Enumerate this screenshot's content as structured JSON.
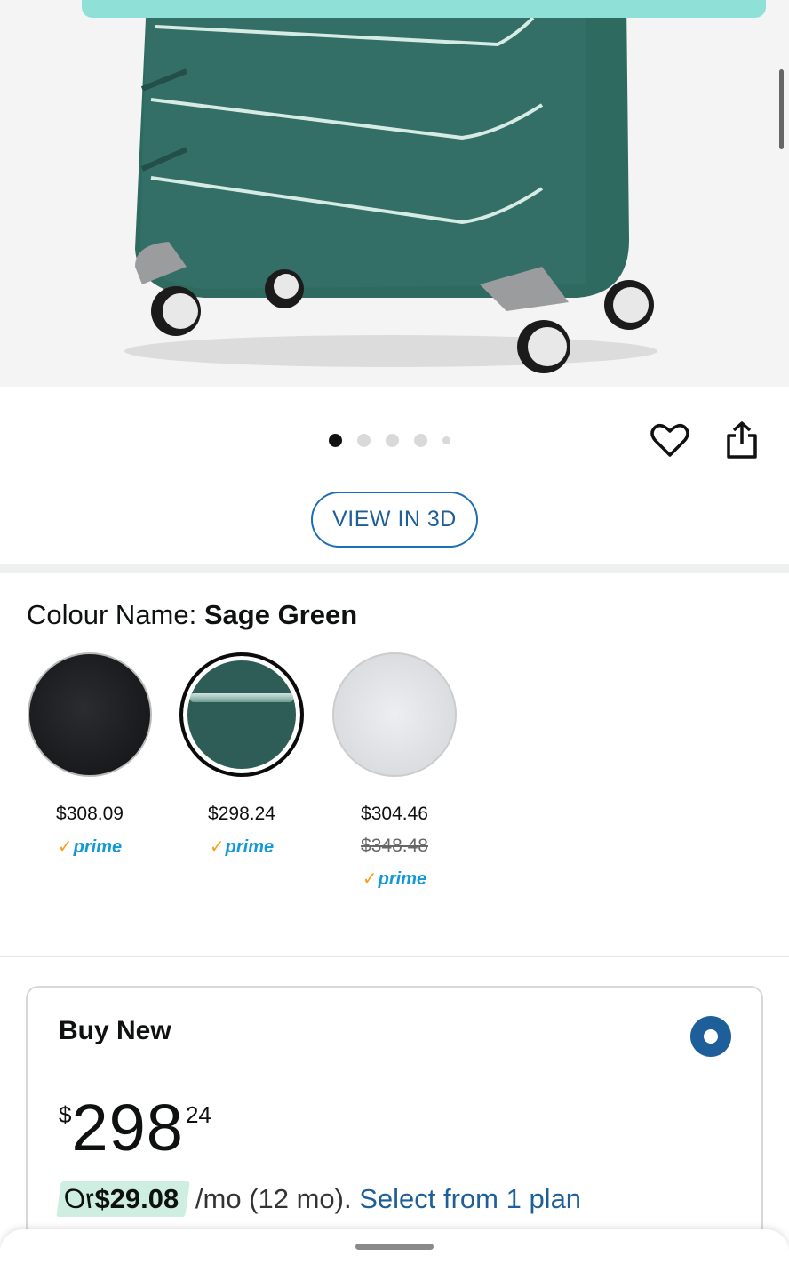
{
  "product": {
    "image_alt": "Sage green hardside spinner suitcase",
    "carousel": {
      "count": 5,
      "active_index": 0
    }
  },
  "actions": {
    "favorite_icon": "heart-icon",
    "share_icon": "share-icon",
    "view_3d_label": "VIEW IN 3D"
  },
  "colour": {
    "label": "Colour Name: ",
    "selected": "Sage Green",
    "options": [
      {
        "name": "Black",
        "price": "$308.09",
        "prime": "prime"
      },
      {
        "name": "Sage Green",
        "price": "$298.24",
        "prime": "prime"
      },
      {
        "name": "Silver",
        "price": "$304.46",
        "list_price": "$348.48",
        "prime": "prime"
      }
    ]
  },
  "buy_box": {
    "title": "Buy New",
    "price_symbol": "$",
    "price_whole": "298",
    "price_fraction": "24",
    "finance_prefix": "Or ",
    "finance_amount": "$29.08",
    "finance_term": " /mo (12 mo). ",
    "finance_link": "Select from 1 plan"
  },
  "colors": {
    "accent_blue": "#1f5f99",
    "prime_blue": "#1399d6",
    "prime_check": "#f6a01a",
    "finance_highlight": "#cdeee0"
  }
}
